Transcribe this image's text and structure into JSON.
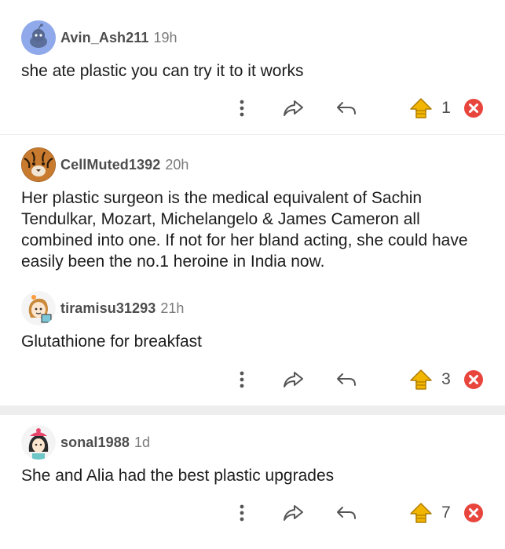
{
  "comments": [
    {
      "username": "Avin_Ash211",
      "time": "19h",
      "text": "she ate plastic you can try it to it works",
      "votes": "1",
      "avatar": "snoo-avatar-blue"
    },
    {
      "username": "CellMuted1392",
      "time": "20h",
      "text": "Her plastic surgeon is the medical equivalent of Sachin Tendulkar, Mozart, Michelangelo & James Cameron all combined into one. If not for her bland acting, she could have easily been the no.1 heroine in India now.",
      "avatar": "tiger-avatar"
    },
    {
      "username": "tiramisu31293",
      "time": "21h",
      "text": "Glutathione for breakfast",
      "votes": "3",
      "avatar": "cartoon-avatar-orange"
    },
    {
      "username": "sonal1988",
      "time": "1d",
      "text": "She and Alia had the best plastic upgrades",
      "votes": "7",
      "avatar": "cartoon-avatar-pink"
    }
  ],
  "colors": {
    "upvote": "#f2b600",
    "downvote": "#e8453c",
    "icon_gray": "#555555",
    "separator": "#eeeeee"
  }
}
